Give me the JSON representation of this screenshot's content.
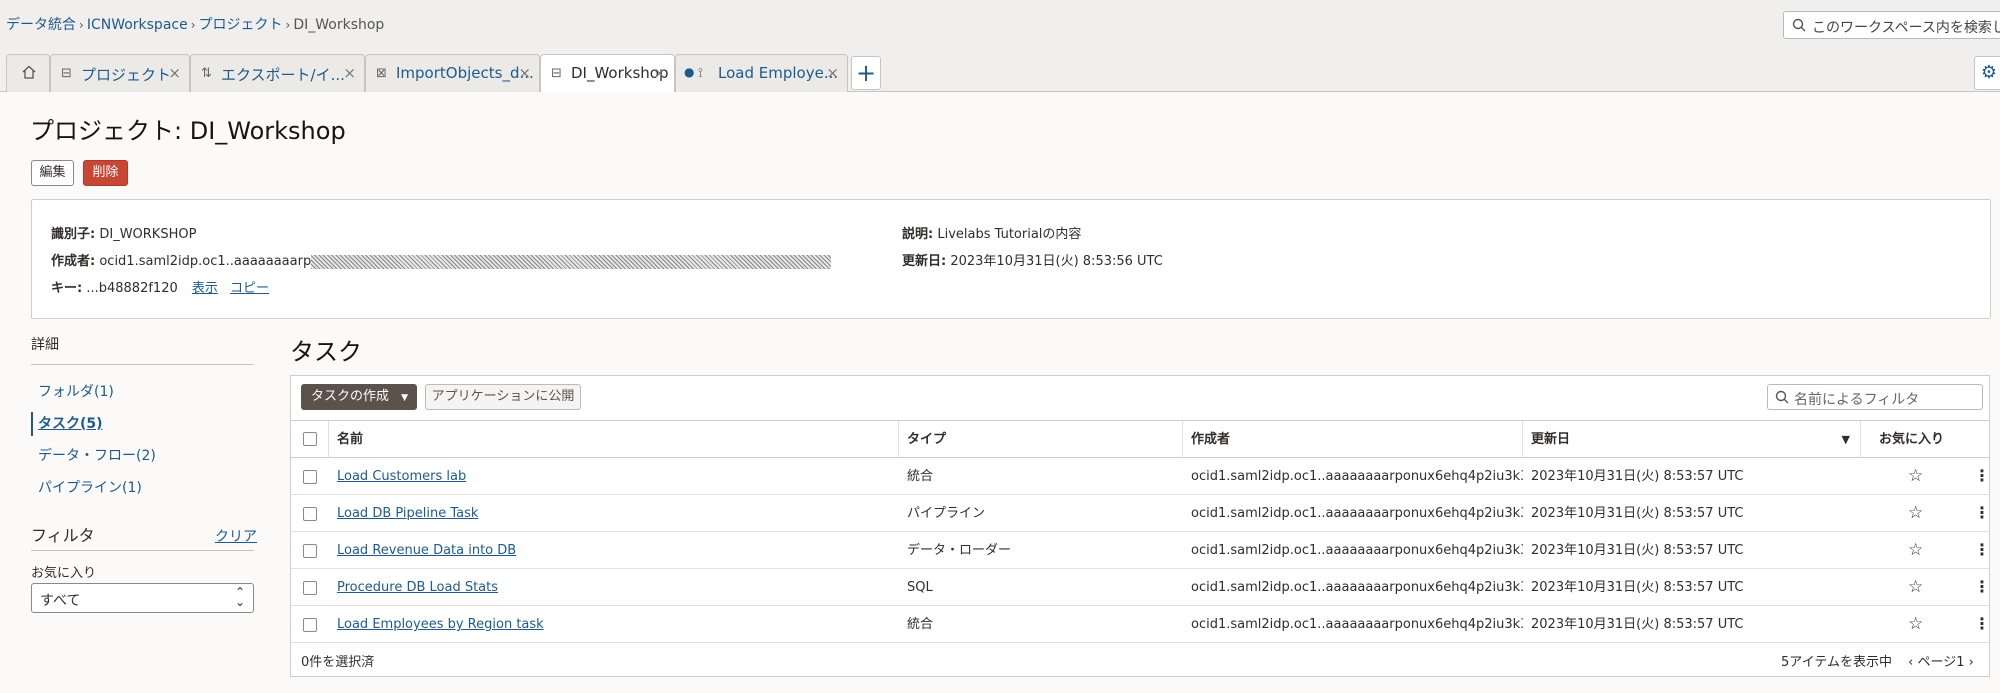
{
  "breadcrumb": [
    {
      "label": "データ統合"
    },
    {
      "label": "ICNWorkspace"
    },
    {
      "label": "プロジェクト"
    },
    {
      "label": "DI_Workshop"
    }
  ],
  "global_search": {
    "placeholder": "このワークスペース内を検索します"
  },
  "tabs": [
    {
      "label": "プロジェクト",
      "icon": "project-icon"
    },
    {
      "label": "エクスポート/イ...",
      "icon": "export-icon"
    },
    {
      "label": "ImportObjects_d...",
      "icon": "import-icon"
    },
    {
      "label": "DI_Workshop",
      "icon": "project-icon",
      "active": true
    },
    {
      "label": "Load Employe...",
      "icon": "pipeline-icon"
    }
  ],
  "page": {
    "title": "プロジェクト: DI_Workshop",
    "edit_label": "編集",
    "delete_label": "削除"
  },
  "info": {
    "identifier_label": "識別子:",
    "identifier": "DI_WORKSHOP",
    "creator_label": "作成者:",
    "creator": "ocid1.saml2idp.oc1..aaaaaaaarp",
    "key_label": "キー:",
    "key": "...b48882f120",
    "show_label": "表示",
    "copy_label": "コピー",
    "description_label": "説明:",
    "description": "Livelabs Tutorialの内容",
    "updated_label": "更新日:",
    "updated": "2023年10月31日(火) 8:53:56 UTC"
  },
  "details": {
    "heading": "詳細",
    "items": [
      {
        "label": "フォルダ(1)"
      },
      {
        "label": "タスク(5)",
        "active": true
      },
      {
        "label": "データ・フロー(2)"
      },
      {
        "label": "パイプライン(1)"
      }
    ]
  },
  "filter": {
    "heading": "フィルタ",
    "clear_label": "クリア",
    "favorites_label": "お気に入り",
    "favorites_value": "すべて"
  },
  "tasks": {
    "title": "タスク",
    "create_label": "タスクの作成",
    "publish_label": "アプリケーションに公開",
    "filter_placeholder": "名前によるフィルタ",
    "columns": {
      "name": "名前",
      "type": "タイプ",
      "creator": "作成者",
      "updated": "更新日",
      "favorite": "お気に入り"
    },
    "rows": [
      {
        "name": "Load Customers lab",
        "type": "統合",
        "creator": "ocid1.saml2idp.oc1..aaaaaaaarponux6ehq4p2iu3k3...",
        "updated": "2023年10月31日(火) 8:53:57 UTC"
      },
      {
        "name": "Load DB Pipeline Task",
        "type": "パイプライン",
        "creator": "ocid1.saml2idp.oc1..aaaaaaaarponux6ehq4p2iu3k3...",
        "updated": "2023年10月31日(火) 8:53:57 UTC"
      },
      {
        "name": "Load Revenue Data into DB",
        "type": "データ・ローダー",
        "creator": "ocid1.saml2idp.oc1..aaaaaaaarponux6ehq4p2iu3k3...",
        "updated": "2023年10月31日(火) 8:53:57 UTC"
      },
      {
        "name": "Procedure DB Load Stats",
        "type": "SQL",
        "creator": "ocid1.saml2idp.oc1..aaaaaaaarponux6ehq4p2iu3k3...",
        "updated": "2023年10月31日(火) 8:53:57 UTC"
      },
      {
        "name": "Load Employees by Region task",
        "type": "統合",
        "creator": "ocid1.saml2idp.oc1..aaaaaaaarponux6ehq4p2iu3k3...",
        "updated": "2023年10月31日(火) 8:53:57 UTC"
      }
    ],
    "selected_text": "0件を選択済",
    "items_text": "5アイテムを表示中",
    "page_text": "ページ1"
  },
  "colors": {
    "link": "#1e5a8c",
    "delete_button": "#c74634",
    "create_button": "#5b524b"
  }
}
